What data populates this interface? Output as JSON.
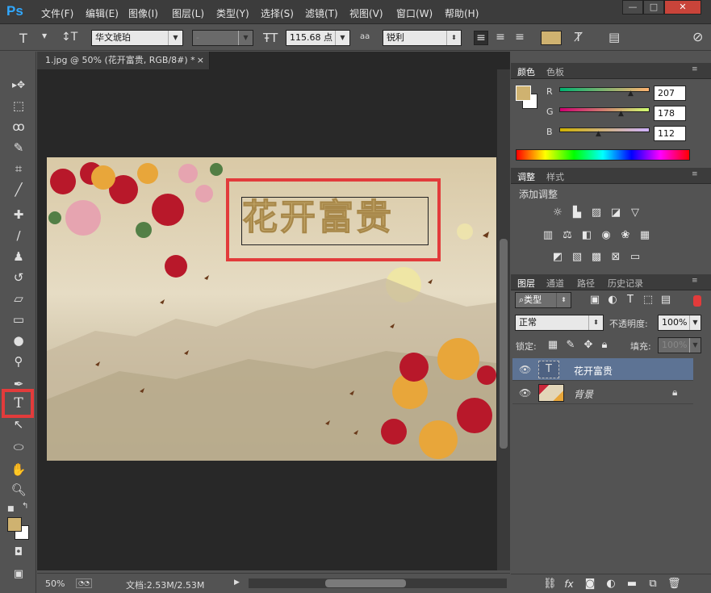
{
  "app_logo": "Ps",
  "menu": [
    "文件(F)",
    "编辑(E)",
    "图像(I)",
    "图层(L)",
    "类型(Y)",
    "选择(S)",
    "滤镜(T)",
    "视图(V)",
    "窗口(W)",
    "帮助(H)"
  ],
  "window_controls": [
    "—",
    "□",
    "✕"
  ],
  "options": {
    "font_family": "华文琥珀",
    "font_style": "-",
    "font_size": "115.68 点",
    "aa_label": "aa",
    "antialias": "锐利"
  },
  "document": {
    "tab_title": "1.jpg @ 50% (花开富贵, RGB/8#) *",
    "close": "×",
    "text_layer": "花开富贵"
  },
  "status": {
    "zoom": "50%",
    "doc_info": "文档:2.53M/2.53M"
  },
  "color_panel": {
    "tabs": [
      "颜色",
      "色板"
    ],
    "r_label": "R",
    "g_label": "G",
    "b_label": "B",
    "r": "207",
    "g": "178",
    "b": "112",
    "fg_color": "#cfb270"
  },
  "adjust_panel": {
    "tabs": [
      "调整",
      "样式"
    ],
    "title": "添加调整"
  },
  "layers_panel": {
    "tabs": [
      "图层",
      "通道",
      "路径",
      "历史记录"
    ],
    "kind": "类型",
    "blend": "正常",
    "opacity_label": "不透明度:",
    "opacity": "100%",
    "lock_label": "锁定:",
    "fill_label": "填充:",
    "fill": "100%",
    "layers": [
      {
        "name": "花开富贵",
        "type": "T"
      },
      {
        "name": "背景"
      }
    ]
  },
  "colors": {
    "accent_red": "#e23b3b",
    "selected_layer": "#5d7394"
  }
}
